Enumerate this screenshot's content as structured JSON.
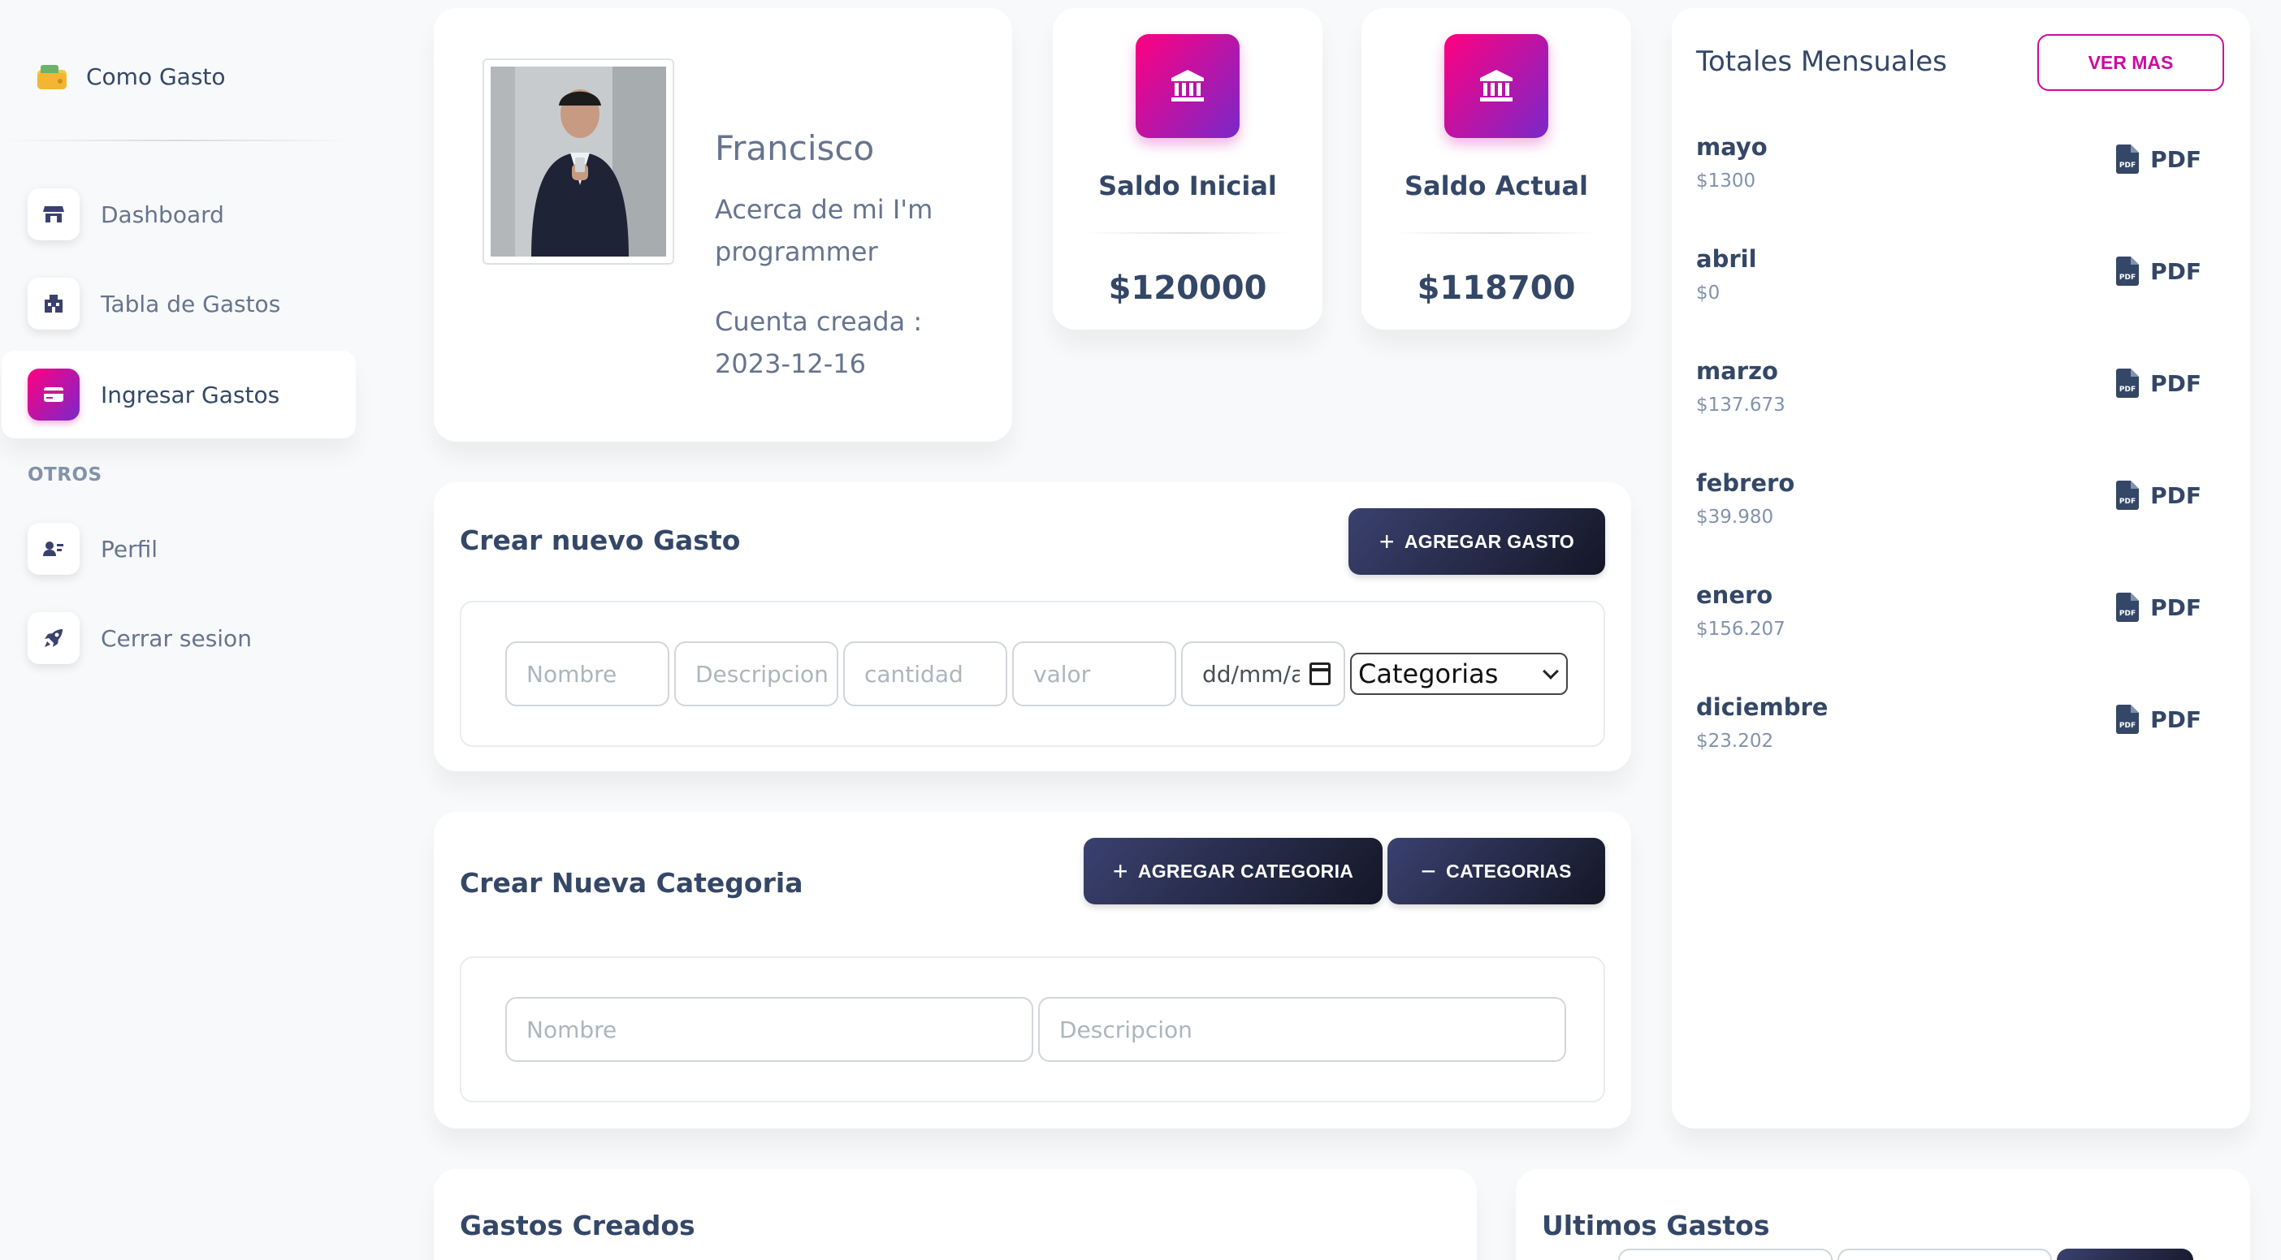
{
  "sidebar": {
    "brand": "Como Gasto",
    "items": [
      {
        "label": "Dashboard",
        "icon": "shop-icon"
      },
      {
        "label": "Tabla de Gastos",
        "icon": "office-icon"
      },
      {
        "label": "Ingresar Gastos",
        "icon": "credit-card-icon",
        "active": true
      }
    ],
    "section_label": "OTROS",
    "other_items": [
      {
        "label": "Perfil",
        "icon": "user-card-icon"
      },
      {
        "label": "Cerrar sesion",
        "icon": "rocket-icon"
      }
    ]
  },
  "profile": {
    "name": "Francisco",
    "about": "Acerca de mi I'm programmer",
    "created": "Cuenta creada : 2023-12-16"
  },
  "stats": [
    {
      "title": "Saldo Inicial",
      "value": "$120000",
      "icon": "bank-icon"
    },
    {
      "title": "Saldo Actual",
      "value": "$118700",
      "icon": "bank-icon"
    }
  ],
  "monthly": {
    "title": "Totales Mensuales",
    "button": "VER MAS",
    "pdf_label": "PDF",
    "months": [
      {
        "name": "mayo",
        "total": "$1300"
      },
      {
        "name": "abril",
        "total": "$0"
      },
      {
        "name": "marzo",
        "total": "$137.673"
      },
      {
        "name": "febrero",
        "total": "$39.980"
      },
      {
        "name": "enero",
        "total": "$156.207"
      },
      {
        "name": "diciembre",
        "total": "$23.202"
      }
    ]
  },
  "new_expense": {
    "title": "Crear nuevo Gasto",
    "button": "AGREGAR GASTO",
    "placeholders": {
      "nombre": "Nombre",
      "descripcion": "Descripcion",
      "cantidad": "cantidad",
      "valor": "valor"
    },
    "date_value": "dd/mm/aaaa",
    "category_select": "Categorias"
  },
  "new_category": {
    "title": "Crear Nueva Categoria",
    "add_button": "AGREGAR CATEGORIA",
    "categories_button": "CATEGORIAS",
    "placeholders": {
      "nombre": "Nombre",
      "descripcion": "Descripcion"
    }
  },
  "created_expenses": {
    "title": "Gastos Creados"
  },
  "latest_expenses": {
    "title": "Ultimos Gastos"
  },
  "colors": {
    "accent": "#cb0c9f",
    "dark": "#344767",
    "muted": "#8392ab"
  }
}
